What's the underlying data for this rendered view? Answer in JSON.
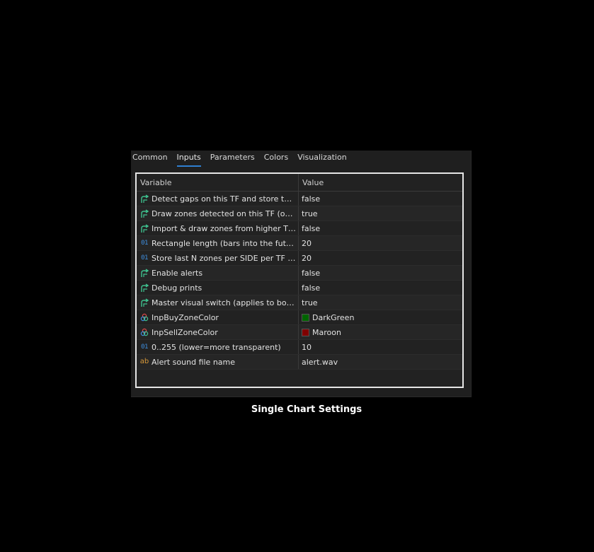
{
  "tabs": [
    {
      "label": "Common",
      "active": false
    },
    {
      "label": "Inputs",
      "active": true
    },
    {
      "label": "Parameters",
      "active": false
    },
    {
      "label": "Colors",
      "active": false
    },
    {
      "label": "Visualization",
      "active": false
    }
  ],
  "grid": {
    "col_variable": "Variable",
    "col_value": "Value",
    "rows": [
      {
        "icon": "bool-arrow-icon",
        "variable": "Detect gaps on this TF and store them t...",
        "value": "false"
      },
      {
        "icon": "bool-arrow-icon",
        "variable": "Draw zones detected on this TF (own zo...",
        "value": "true"
      },
      {
        "icon": "bool-arrow-icon",
        "variable": "Import & draw zones from higher TFs (GV)",
        "value": "false"
      },
      {
        "icon": "integer-icon",
        "variable": "Rectangle length (bars into the future o...",
        "value": "20"
      },
      {
        "icon": "integer-icon",
        "variable": "Store last N zones per SIDE per TF (per ...",
        "value": "20"
      },
      {
        "icon": "bool-arrow-icon",
        "variable": "Enable alerts",
        "value": "false"
      },
      {
        "icon": "bool-arrow-icon",
        "variable": "Debug prints",
        "value": "false"
      },
      {
        "icon": "bool-arrow-icon",
        "variable": "Master visual switch (applies to both ow...",
        "value": "true"
      },
      {
        "icon": "color-icon",
        "variable": "InpBuyZoneColor",
        "value": "DarkGreen",
        "swatch": "#006400"
      },
      {
        "icon": "color-icon",
        "variable": "InpSellZoneColor",
        "value": "Maroon",
        "swatch": "#800000"
      },
      {
        "icon": "integer-icon",
        "variable": "0..255 (lower=more transparent)",
        "value": "10"
      },
      {
        "icon": "string-icon",
        "variable": "Alert sound file name",
        "value": "alert.wav"
      }
    ]
  },
  "icon_glyphs": {
    "integer": "01",
    "string": "ab"
  },
  "caption": "Single Chart Settings",
  "colors": {
    "accent_tab": "#2f7fd1",
    "bool_icon": "#3fc28f",
    "int_icon": "#3f8fe0",
    "string_icon": "#d99a3a"
  }
}
